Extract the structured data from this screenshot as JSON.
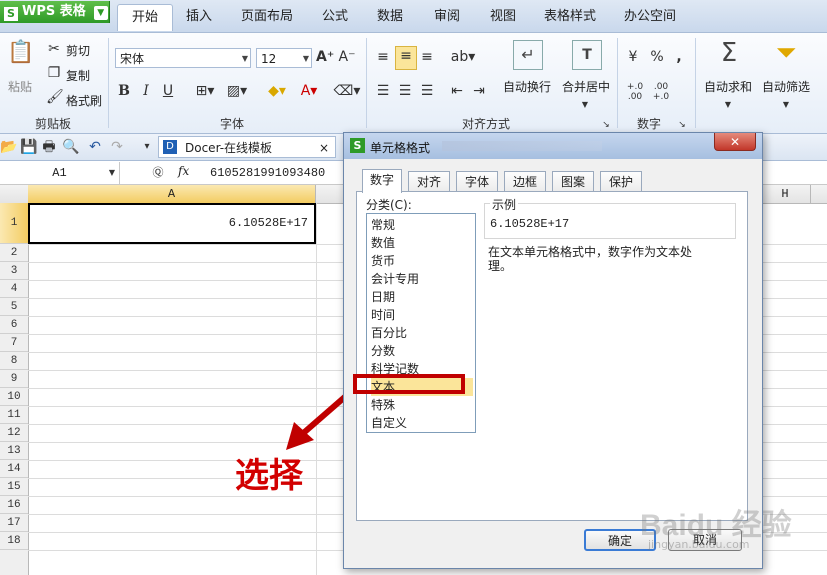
{
  "app": {
    "wps_label": "WPS 表格",
    "tabs": [
      "开始",
      "插入",
      "页面布局",
      "公式",
      "数据",
      "审阅",
      "视图",
      "表格样式",
      "办公空间"
    ],
    "active_tab": "开始"
  },
  "ribbon": {
    "paste_label": "粘贴",
    "cut_label": "剪切",
    "copy_label": "复制",
    "format_painter_label": "格式刷",
    "clipboard_group": "剪贴板",
    "font_name": "宋体",
    "font_size": "12",
    "font_group": "字体",
    "wrap_text_label": "自动换行",
    "merge_center_label": "合并居中",
    "align_group": "对齐方式",
    "number_group": "数字",
    "autosum_label": "自动求和",
    "autofilter_label": "自动筛选"
  },
  "quickbar": {
    "doc_tab": "Docer-在线模板"
  },
  "formula_bar": {
    "name_box": "A1",
    "fx": "fx",
    "content": "6105281991093480"
  },
  "sheet": {
    "col_a": "A",
    "col_h": "H",
    "rows": [
      "1",
      "2",
      "3",
      "4",
      "5",
      "6",
      "7",
      "8",
      "9",
      "10",
      "11",
      "12",
      "13",
      "14",
      "15",
      "16",
      "17",
      "18"
    ],
    "a1_value": "6.10528E+17"
  },
  "dialog": {
    "title": "单元格格式",
    "tabs": [
      "数字",
      "对齐",
      "字体",
      "边框",
      "图案",
      "保护"
    ],
    "active_tab": "数字",
    "category_label": "分类(C):",
    "categories": [
      "常规",
      "数值",
      "货币",
      "会计专用",
      "日期",
      "时间",
      "百分比",
      "分数",
      "科学记数",
      "文本",
      "特殊",
      "自定义"
    ],
    "selected_category": "文本",
    "sample_label": "示例",
    "sample_value": "6.10528E+17",
    "description": "在文本单元格格式中，数字作为文本处理。",
    "ok_label": "确定",
    "cancel_label": "取消"
  },
  "annotation": {
    "label": "选择"
  },
  "watermark": {
    "text": "Baidu 经验",
    "url": "jingyan.baidu.com"
  },
  "colors": {
    "highlight_red": "#c00000",
    "selected_item": "#fbe59a",
    "wps_green": "#2e9a27"
  }
}
